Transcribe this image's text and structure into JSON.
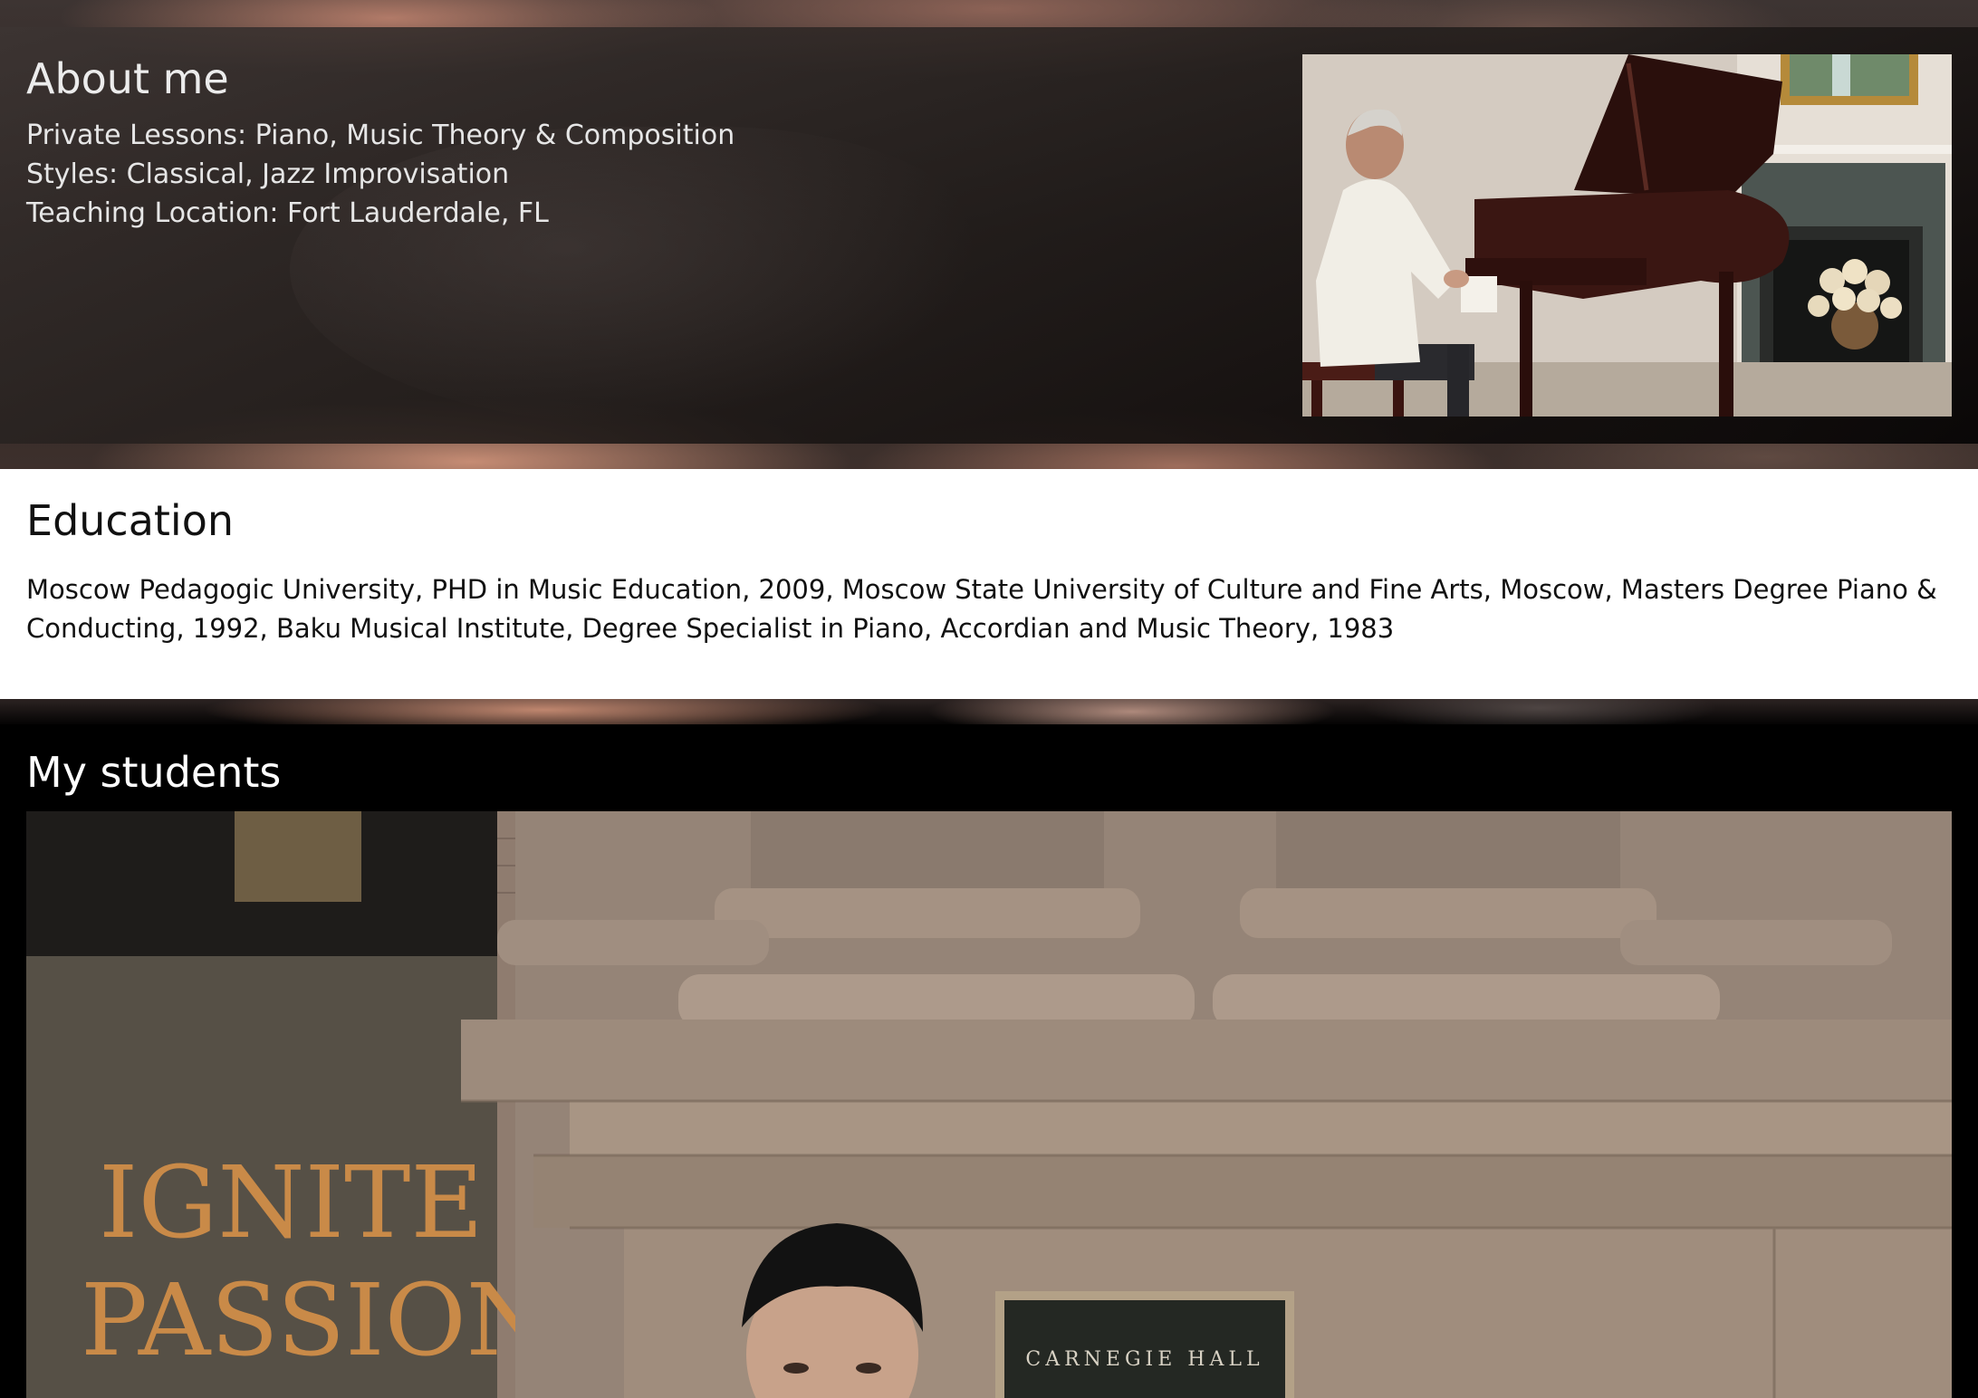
{
  "about": {
    "title": "About me",
    "lines": [
      "Private Lessons: Piano, Music Theory & Composition",
      "Styles: Classical, Jazz Improvisation",
      "Teaching Location: Fort Lauderdale, FL"
    ]
  },
  "education": {
    "title": "Education",
    "text": "Moscow Pedagogic University, PHD in Music Education, 2009, Moscow State University of Culture and Fine Arts, Moscow, Masters Degree Piano & Conducting, 1992, Baku Musical Institute, Degree Specialist in Piano, Accordian and Music Theory, 1983"
  },
  "students": {
    "title": "My students",
    "photo": {
      "store_sign_line1": "IGNITE",
      "store_sign_line2": "PASSION",
      "plaque_text": "CARNEGIE HALL"
    }
  },
  "colors": {
    "about_panel": "#2a2220",
    "education_bg": "#ffffff",
    "students_bg": "#000000",
    "heading_light": "#ececec",
    "text_dark": "#111111"
  },
  "icons": {
    "piano_photo": "piano-player-photo",
    "students_photo": "carnegie-hall-student-photo"
  }
}
